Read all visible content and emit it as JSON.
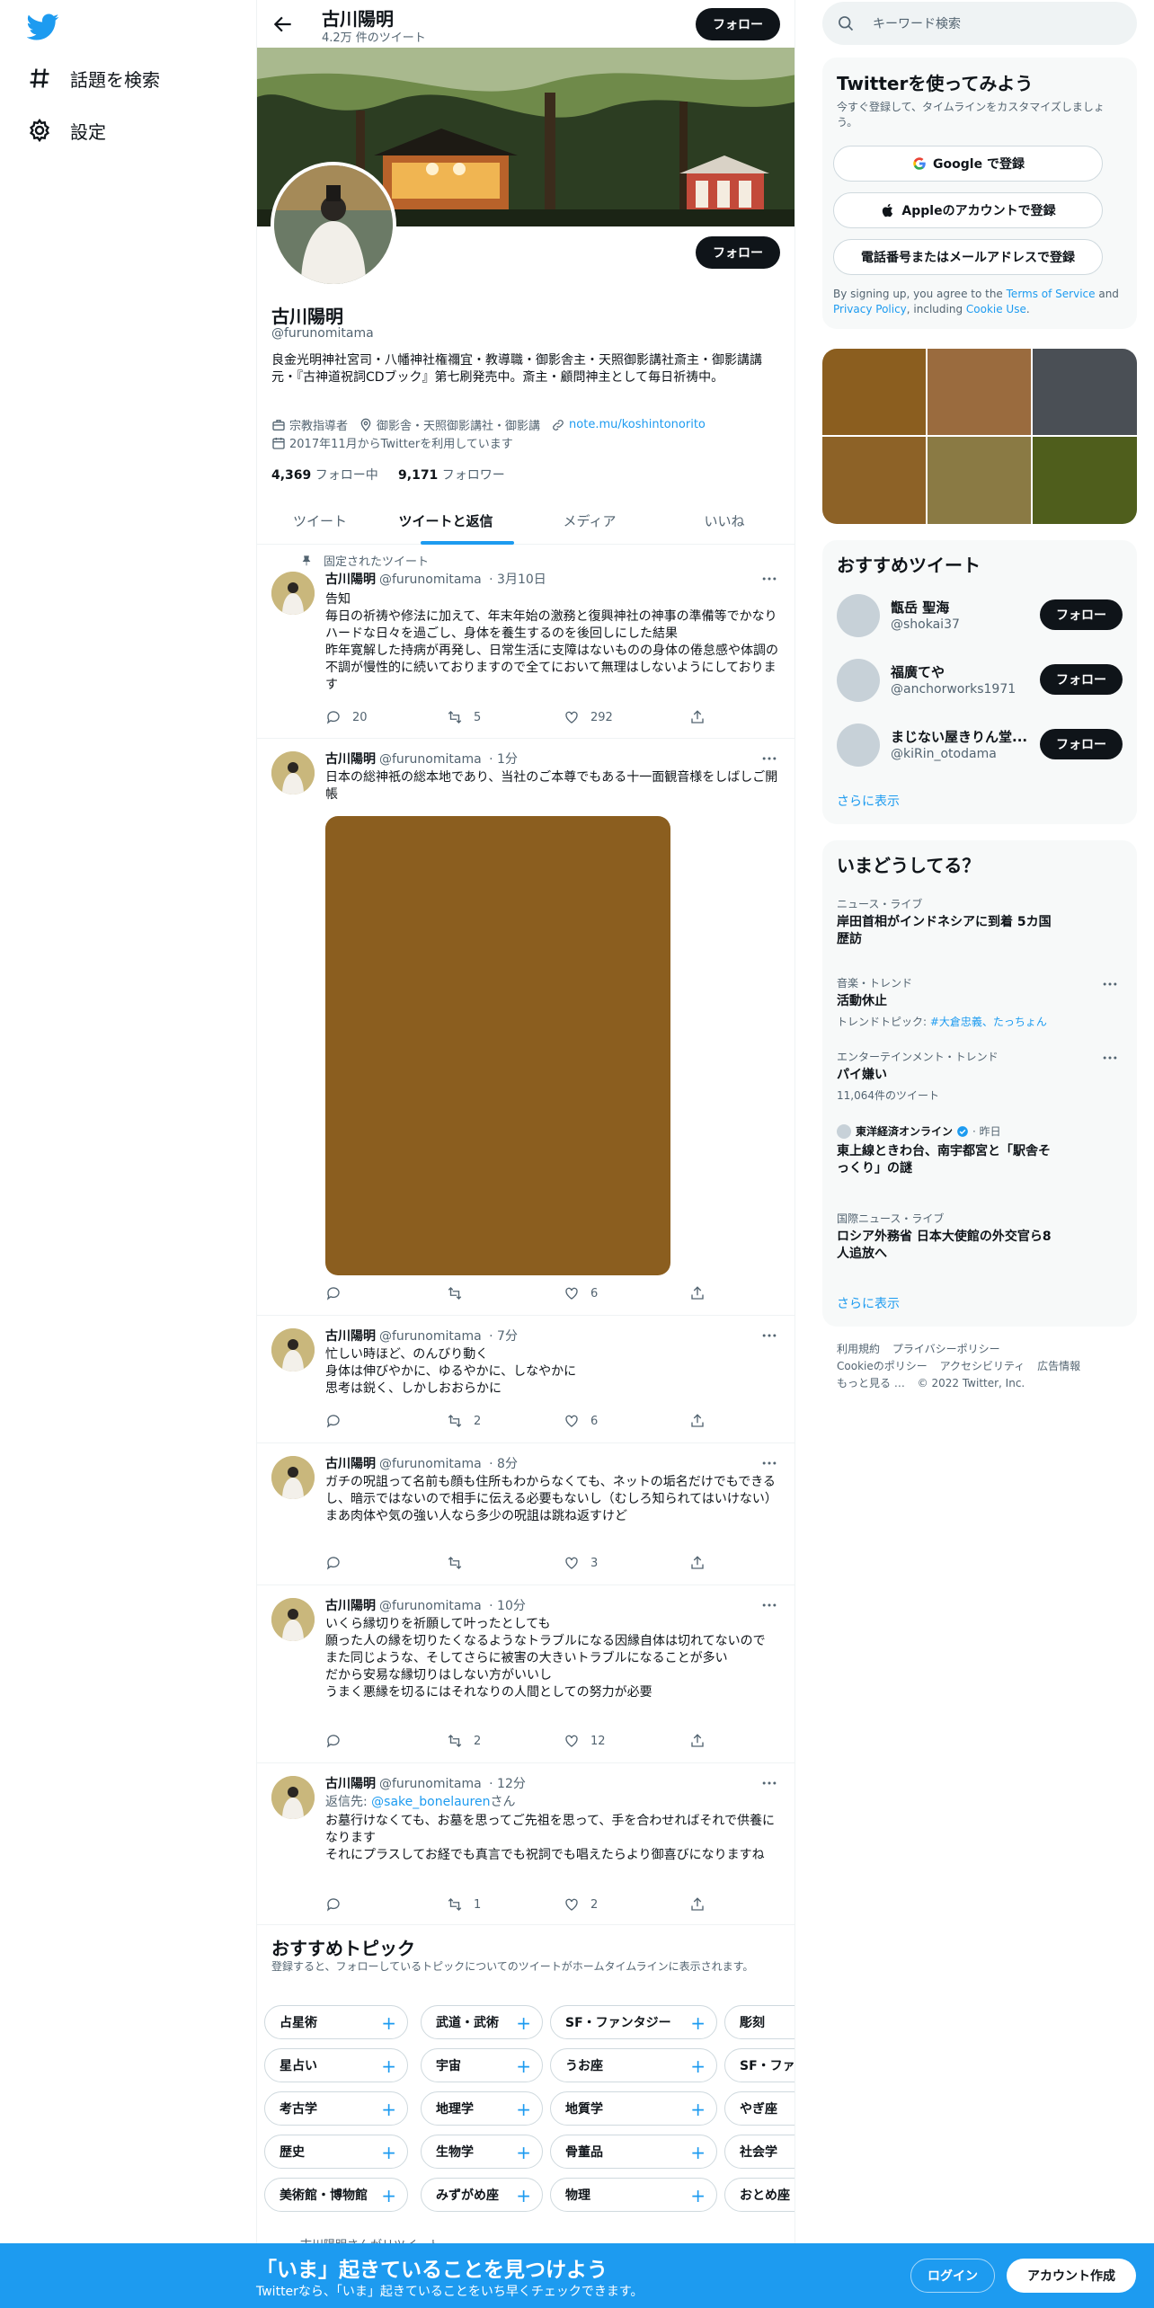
{
  "nav": {
    "explore_label": "話題を検索",
    "settings_label": "設定"
  },
  "topbar": {
    "name": "古川陽明",
    "tweet_count": "4.2万 件のツイート",
    "follow_label": "フォロー"
  },
  "profile": {
    "name": "古川陽明",
    "handle": "@furunomitama",
    "bio": "良金光明神社宮司・八幡神社権禰宜・教導職・御影舎主・天照御影講社斎主・御影講講元・『古神道祝詞CDブック』第七刷発売中。斎主・顧問神主として毎日祈祷中。",
    "category": "宗教指導者",
    "location": "御影舎・天照御影講社・御影講",
    "link": "note.mu/koshintonorito",
    "joined": "2017年11月からTwitterを利用しています",
    "following_count": "4,369",
    "following_label": "フォロー中",
    "followers_count": "9,171",
    "followers_label": "フォロワー",
    "follow_label": "フォロー"
  },
  "tabs": [
    "ツイート",
    "ツイートと返信",
    "メディア",
    "いいね"
  ],
  "pinned_label": "固定されたツイート",
  "tweets": [
    {
      "name": "古川陽明",
      "handle": "@furunomitama",
      "time": "· 3月10日",
      "text": "告知\n毎日の祈祷や修法に加えて、年末年始の激務と復興神社の神事の準備等でかなりハードな日々を過ごし、身体を養生するのを後回しにした結果\n昨年寛解した持病が再発し、日常生活に支障はないものの身体の倦怠感や体調の不調が慢性的に続いておりますので全てにおいて無理はしないようにしております",
      "replies": "20",
      "retweets": "5",
      "likes": "292"
    },
    {
      "name": "古川陽明",
      "handle": "@furunomitama",
      "time": "· 1分",
      "text": "日本の総神祇の総本地であり、当社のご本尊でもある十一面観音様をしばしご開帳",
      "replies": "",
      "retweets": "",
      "likes": "6"
    },
    {
      "name": "古川陽明",
      "handle": "@furunomitama",
      "time": "· 7分",
      "text": "忙しい時ほど、のんびり動く\n身体は伸びやかに、ゆるやかに、しなやかに\n思考は鋭く、しかしおおらかに",
      "replies": "",
      "retweets": "2",
      "likes": "6"
    },
    {
      "name": "古川陽明",
      "handle": "@furunomitama",
      "time": "· 8分",
      "text": "ガチの呪詛って名前も顔も住所もわからなくても、ネットの垢名だけでもできるし、暗示ではないので相手に伝える必要もないし（むしろ知られてはいけない）\nまあ肉体や気の強い人なら多少の呪詛は跳ね返すけど",
      "replies": "",
      "retweets": "",
      "likes": "3"
    },
    {
      "name": "古川陽明",
      "handle": "@furunomitama",
      "time": "· 10分",
      "text": "いくら縁切りを祈願して叶ったとしても\n願った人の縁を切りたくなるようなトラブルになる因縁自体は切れてないので\nまた同じような、そしてさらに被害の大きいトラブルになることが多い\nだから安易な縁切りはしない方がいいし\nうまく悪縁を切るにはそれなりの人間としての努力が必要",
      "replies": "",
      "retweets": "2",
      "likes": "12"
    },
    {
      "name": "古川陽明",
      "handle": "@furunomitama",
      "time": "· 12分",
      "reply_prefix": "返信先: ",
      "reply_to": "@sake_bonelauren",
      "reply_suffix": "さん",
      "text": "お墓行けなくても、お墓を思ってご先祖を思って、手を合わせればそれで供養になります\nそれにプラスしてお経でも真言でも祝詞でも唱えたらより御喜びになりますね",
      "replies": "",
      "retweets": "1",
      "likes": "2"
    }
  ],
  "topics": {
    "title": "おすすめトピック",
    "subtitle": "登録すると、フォローしているトピックについてのツイートがホームタイムラインに表示されます。",
    "rows": [
      [
        "占星術",
        "武道・武術",
        "SF・ファンタジー",
        "彫刻"
      ],
      [
        "星占い",
        "宇宙",
        "うお座",
        "SF・ファン"
      ],
      [
        "考古学",
        "地理学",
        "地質学",
        "やぎ座"
      ],
      [
        "歴史",
        "生物学",
        "骨董品",
        "社会学"
      ],
      [
        "美術館・博物館",
        "みずがめ座",
        "物理",
        "おとめ座"
      ]
    ]
  },
  "retweeted_note": "古川陽明さんがリツイート",
  "search": {
    "placeholder": "キーワード検索"
  },
  "signup": {
    "title": "Twitterを使ってみよう",
    "subtitle": "今すぐ登録して、タイムラインをカスタマイズしましょう。",
    "google": "Google で登録",
    "apple": "Appleのアカウントで登録",
    "phone": "電話番号またはメールアドレスで登録",
    "legal_1": "By signing up, you agree to the ",
    "terms": "Terms of Service",
    "legal_2": " and ",
    "privacy": "Privacy Policy",
    "legal_3": ", including ",
    "cookie": "Cookie Use",
    "legal_4": "."
  },
  "photo_colors": [
    "#8b5e1f",
    "#9a6b3e",
    "#4a4f55",
    "#8d6227",
    "#8a7a44",
    "#4f5e1c"
  ],
  "recommended": {
    "title": "おすすめツイート",
    "users": [
      {
        "name": "甑岳 聖海",
        "handle": "@shokai37"
      },
      {
        "name": "福廣てや",
        "handle": "@anchorworks1971"
      },
      {
        "name": "まじない屋きりん堂...",
        "handle": "@kiRin_otodama"
      }
    ],
    "follow_label": "フォロー",
    "show_more": "さらに表示"
  },
  "trends": {
    "title": "いまどうしてる？",
    "items": [
      {
        "category": "ニュース・ライブ",
        "title": "岸田首相がインドネシアに到着 5カ国歴訪"
      },
      {
        "category": "音楽・トレンド",
        "title": "活動休止",
        "extra_prefix": "トレンドトピック: ",
        "extra_tags": "#大倉忠義、たっちょん"
      },
      {
        "category": "エンターテインメント・トレンド",
        "title": "パイ嫌い",
        "extra": "11,064件のツイート"
      },
      {
        "category": "東洋経済オンライン",
        "category_time": "· 昨日",
        "title": "東上線ときわ台、南宇都宮と「駅舎そっくり」の謎"
      },
      {
        "category": "国際ニュース・ライブ",
        "title": "ロシア外務省 日本大使館の外交官ら8人追放へ"
      }
    ],
    "show_more": "さらに表示"
  },
  "footer": {
    "links": [
      "利用規約",
      "プライバシーポリシー",
      "Cookieのポリシー",
      "アクセシビリティ",
      "広告情報",
      "もっと見る …"
    ],
    "copyright": "© 2022 Twitter, Inc."
  },
  "bottombar": {
    "title": "「いま」起きていることを見つけよう",
    "subtitle": "Twitterなら、「いま」起きていることをいち早くチェックできます。",
    "login": "ログイン",
    "signup": "アカウント作成"
  },
  "colors": {
    "accent": "#1d9bf0",
    "dark": "#0f1419",
    "muted": "#536471"
  }
}
